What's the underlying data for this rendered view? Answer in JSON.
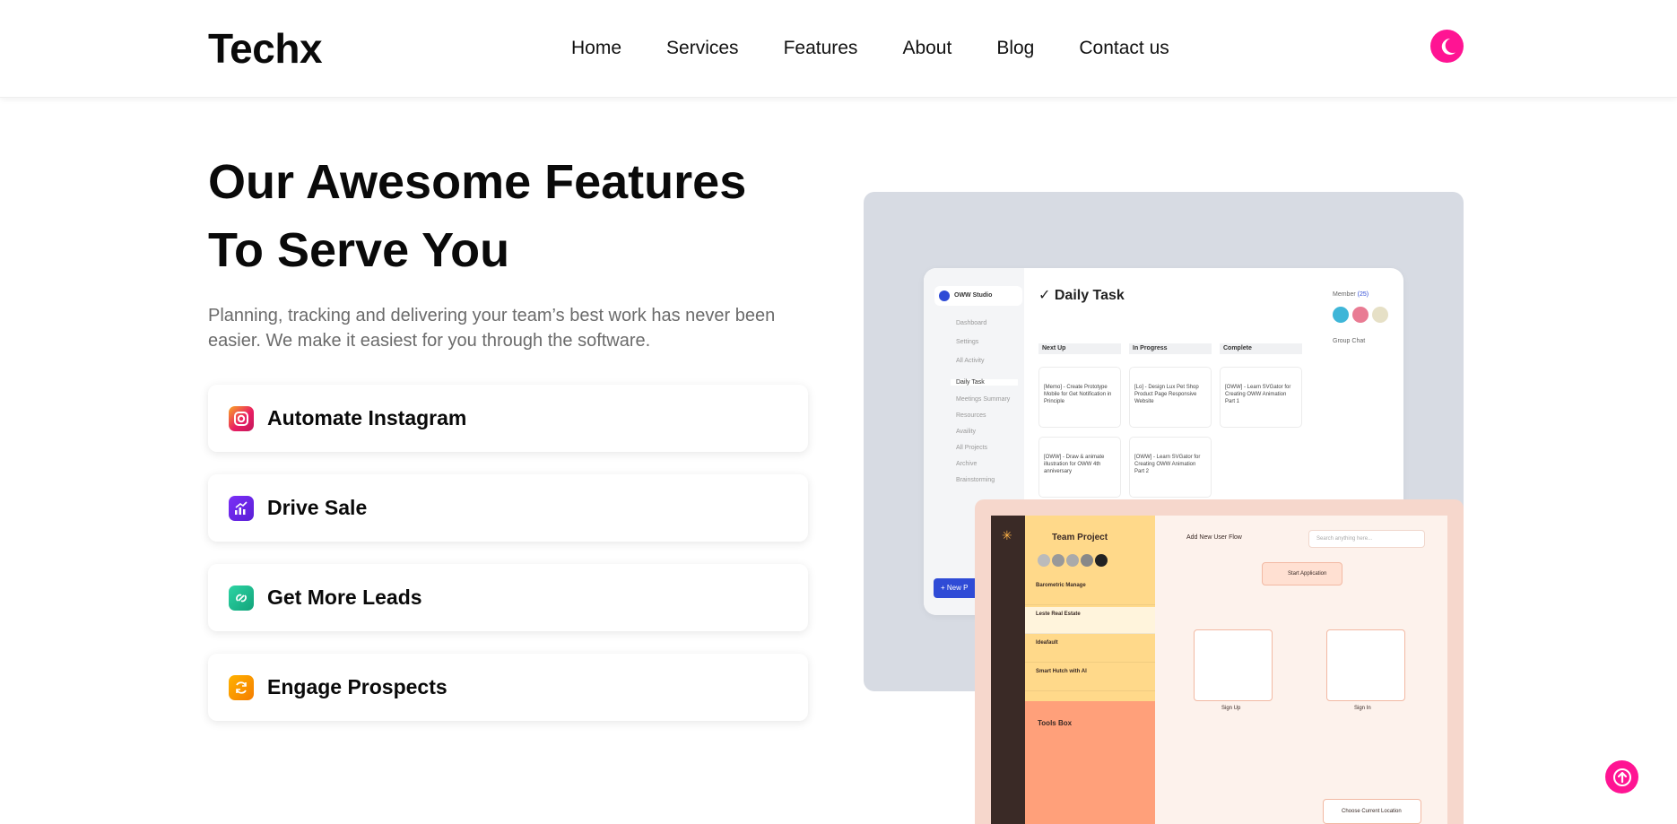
{
  "brand": {
    "name": "Techx"
  },
  "nav": {
    "items": [
      "Home",
      "Services",
      "Features",
      "About",
      "Blog",
      "Contact us"
    ]
  },
  "hero": {
    "title_line1": "Our Awesome Features",
    "title_line2": "To Serve You",
    "subtitle": "Planning, tracking and delivering your team’s best work has never been easier. We make it easiest for you through the software."
  },
  "features": [
    {
      "label": "Automate Instagram",
      "icon": "instagram-icon"
    },
    {
      "label": "Drive Sale",
      "icon": "chart-growth-icon"
    },
    {
      "label": "Get More Leads",
      "icon": "link-icon"
    },
    {
      "label": "Engage Prospects",
      "icon": "refresh-icon"
    }
  ],
  "mockup": {
    "dashboard_title": "Daily Task",
    "workspace": "OWW Studio",
    "sidebar": [
      "Dashboard",
      "Settings",
      "All Activity",
      "Daily Task",
      "Meetings Summary",
      "Resources",
      "Availity",
      "All Projects",
      "Archive",
      "Brainstorming"
    ],
    "columns": [
      "Next Up",
      "In Progress",
      "Complete"
    ],
    "members_label": "Member",
    "members_count": "(25)",
    "group_chat": "Group Chat",
    "new_button": "New P",
    "team_title": "Team Project",
    "add_flow": "Add New User Flow",
    "search_placeholder": "Search anything here...",
    "start_application": "Start Application",
    "sign_up": "Sign Up",
    "sign_in": "Sign In",
    "tools_box": "Tools Box",
    "choose_location": "Choose Current Location",
    "projects": [
      "Barometric Manage",
      "Leste Real Estate",
      "Ideafault",
      "Smart Hutch with AI"
    ]
  },
  "colors": {
    "accent": "#ff1493",
    "text": "#0a0a0a",
    "muted": "#6b6b6b"
  }
}
